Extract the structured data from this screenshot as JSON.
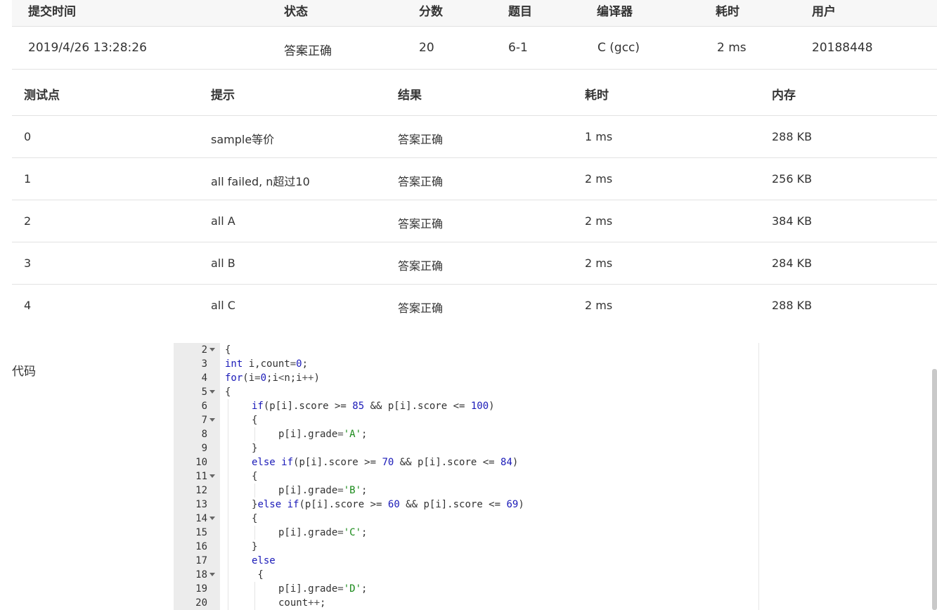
{
  "submission": {
    "headers": [
      "提交时间",
      "状态",
      "分数",
      "题目",
      "编译器",
      "耗时",
      "用户"
    ],
    "row": {
      "time": "2019/4/26 13:28:26",
      "status": "答案正确",
      "score": "20",
      "problem": "6-1",
      "compiler": "C (gcc)",
      "duration": "2 ms",
      "user": "20188448"
    }
  },
  "testcases": {
    "headers": [
      "测试点",
      "提示",
      "结果",
      "耗时",
      "内存"
    ],
    "rows": [
      {
        "id": "0",
        "hint": "sample等价",
        "result": "答案正确",
        "time": "1 ms",
        "memory": "288 KB"
      },
      {
        "id": "1",
        "hint": "all failed, n超过10",
        "result": "答案正确",
        "time": "2 ms",
        "memory": "256 KB"
      },
      {
        "id": "2",
        "hint": "all A",
        "result": "答案正确",
        "time": "2 ms",
        "memory": "384 KB"
      },
      {
        "id": "3",
        "hint": "all B",
        "result": "答案正确",
        "time": "2 ms",
        "memory": "284 KB"
      },
      {
        "id": "4",
        "hint": "all C",
        "result": "答案正确",
        "time": "2 ms",
        "memory": "288 KB"
      }
    ]
  },
  "code": {
    "label": "代码",
    "lines": [
      {
        "n": "2",
        "fold": true,
        "indent": 0,
        "text": "{"
      },
      {
        "n": "3",
        "fold": false,
        "indent": 0,
        "text": "int i,count=0;"
      },
      {
        "n": "4",
        "fold": false,
        "indent": 0,
        "text": "for(i=0;i<n;i++)"
      },
      {
        "n": "5",
        "fold": true,
        "indent": 0,
        "text": "{"
      },
      {
        "n": "6",
        "fold": false,
        "indent": 1,
        "text": "if(p[i].score >= 85 && p[i].score <= 100)"
      },
      {
        "n": "7",
        "fold": true,
        "indent": 1,
        "text": "{"
      },
      {
        "n": "8",
        "fold": false,
        "indent": 2,
        "text": "p[i].grade='A';"
      },
      {
        "n": "9",
        "fold": false,
        "indent": 1,
        "text": "}"
      },
      {
        "n": "10",
        "fold": false,
        "indent": 1,
        "text": "else if(p[i].score >= 70 && p[i].score <= 84)"
      },
      {
        "n": "11",
        "fold": true,
        "indent": 1,
        "text": "{"
      },
      {
        "n": "12",
        "fold": false,
        "indent": 2,
        "text": "p[i].grade='B';"
      },
      {
        "n": "13",
        "fold": false,
        "indent": 1,
        "text": "}else if(p[i].score >= 60 && p[i].score <= 69)"
      },
      {
        "n": "14",
        "fold": true,
        "indent": 1,
        "text": "{"
      },
      {
        "n": "15",
        "fold": false,
        "indent": 2,
        "text": "p[i].grade='C';"
      },
      {
        "n": "16",
        "fold": false,
        "indent": 1,
        "text": "}"
      },
      {
        "n": "17",
        "fold": false,
        "indent": 1,
        "text": "else"
      },
      {
        "n": "18",
        "fold": true,
        "indent": 1,
        "text": " {"
      },
      {
        "n": "19",
        "fold": false,
        "indent": 2,
        "text": "p[i].grade='D';"
      },
      {
        "n": "20",
        "fold": false,
        "indent": 2,
        "text": "count++;"
      }
    ]
  }
}
